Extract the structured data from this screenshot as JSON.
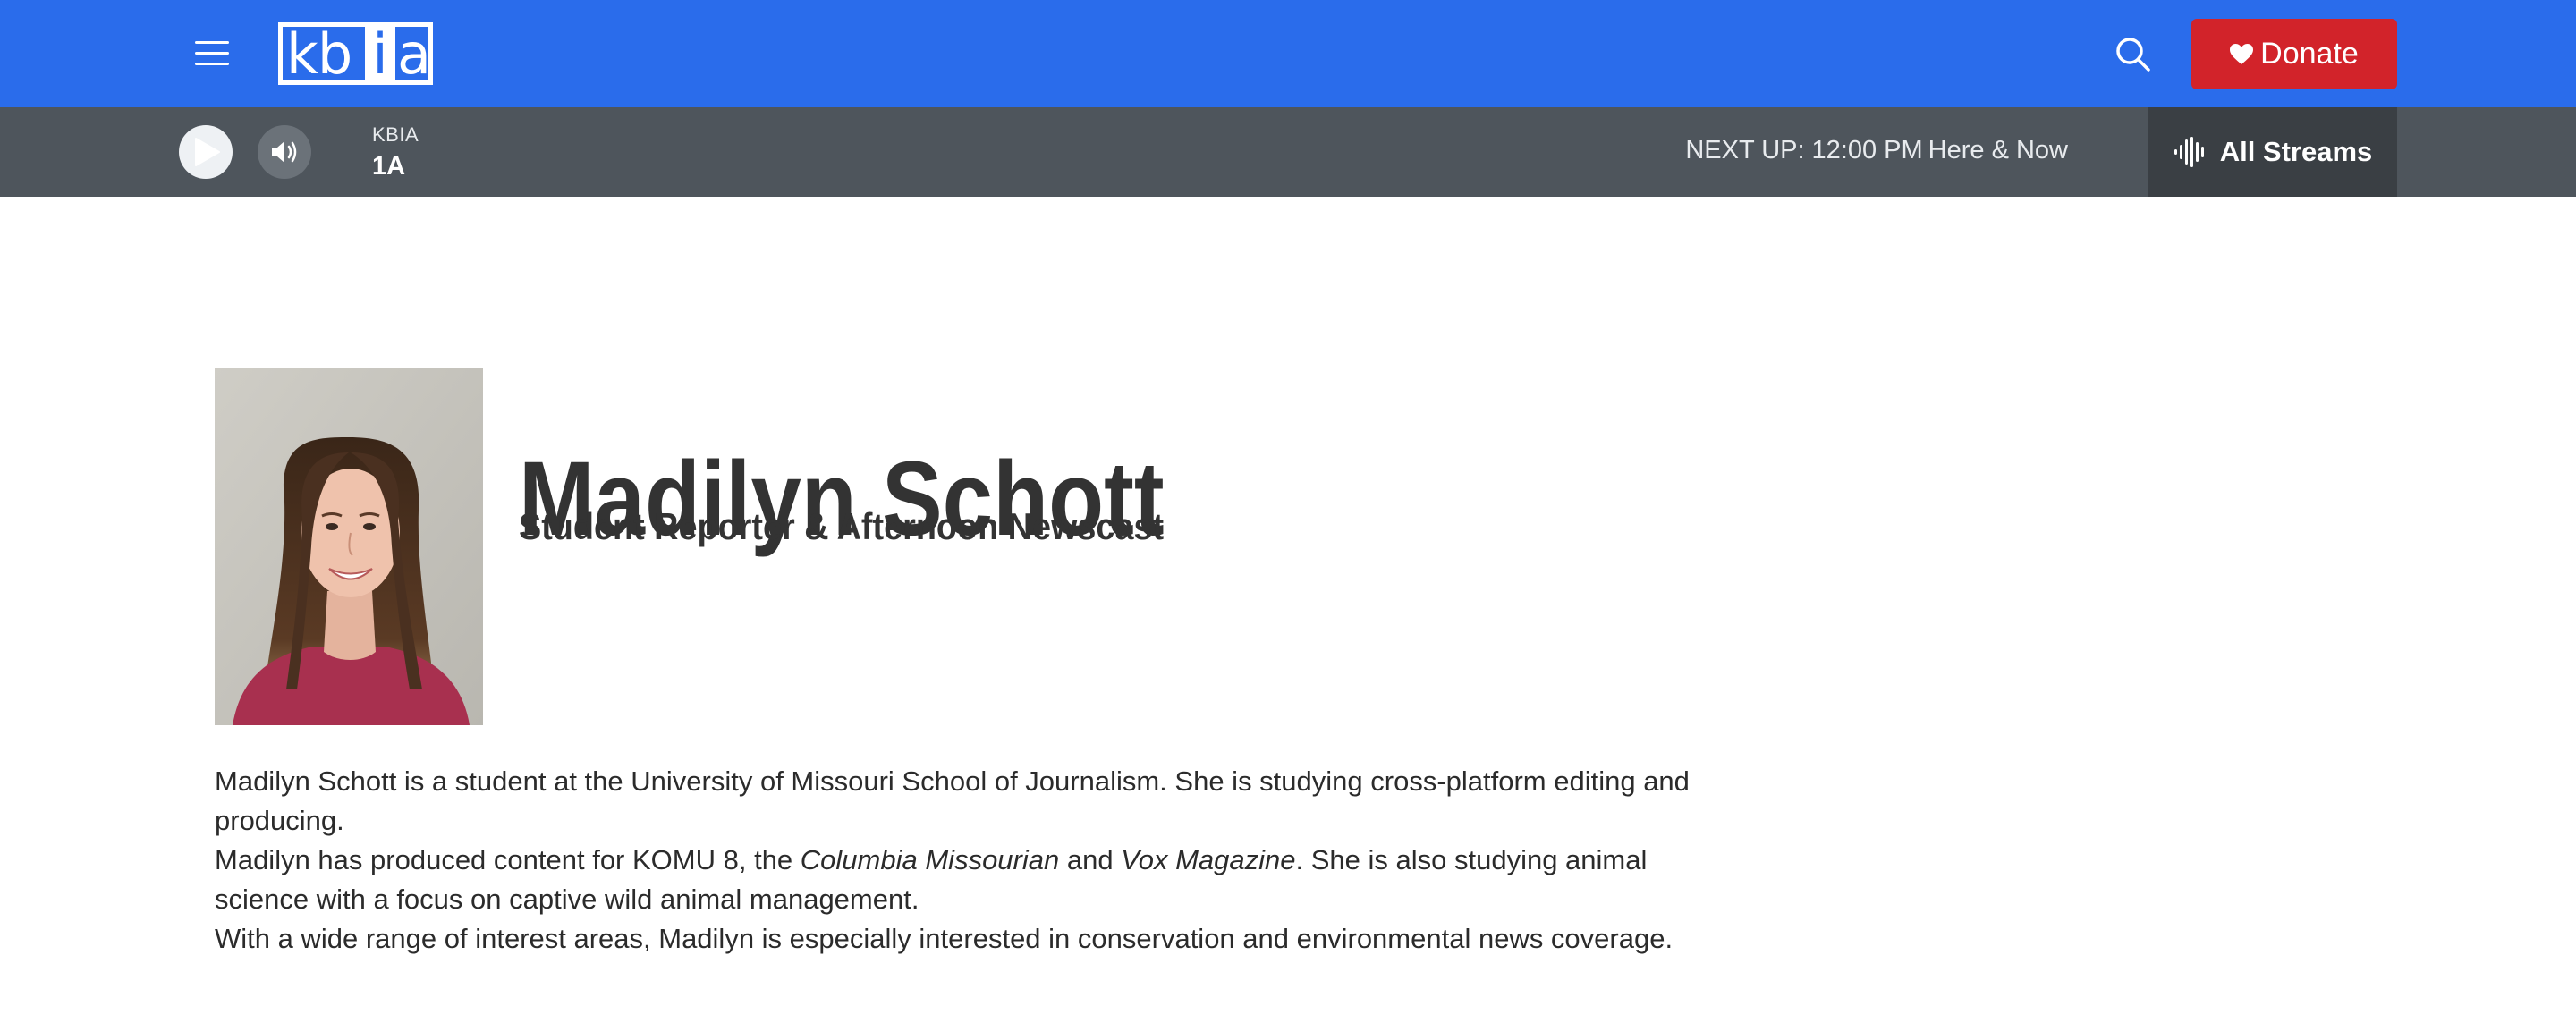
{
  "header": {
    "logo_text": {
      "kb": "kb",
      "i": "i",
      "a": "a"
    },
    "donate_label": "Donate",
    "colors": {
      "header_bg": "#2a6ceb",
      "donate_bg": "#d2232a"
    }
  },
  "player": {
    "station": "KBIA",
    "program": "1A",
    "next_up_label": "NEXT UP:",
    "next_up_time": "12:00 PM",
    "next_up_show": "Here & Now",
    "all_streams_label": "All Streams",
    "colors": {
      "bar_bg": "#4e555c",
      "streams_bg": "#3a3f44"
    }
  },
  "profile": {
    "name": "Madilyn Schott",
    "title": "Student Reporter & Afternoon Newscast",
    "photo_icon": "portrait-photo"
  },
  "bio": {
    "p1": "Madilyn Schott is a student at the University of Missouri School of Journalism. She is studying cross-platform editing and producing.",
    "p2_a": "Madilyn has produced content for KOMU 8, the ",
    "p2_em1": "Columbia Missourian",
    "p2_b": " and ",
    "p2_em2": "Vox Magazine",
    "p2_c": ". She is also studying animal science with a focus on captive wild animal management.",
    "p3": "With a wide range of interest areas, Madilyn is especially interested in conservation and environmental news coverage."
  }
}
